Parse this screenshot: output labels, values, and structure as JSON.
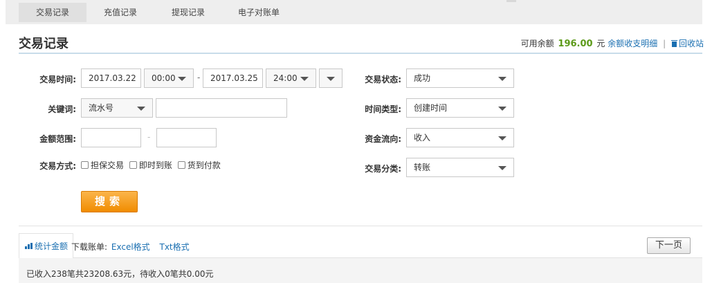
{
  "tabs": [
    {
      "label": "交易记录",
      "active": true
    },
    {
      "label": "充值记录",
      "active": false
    },
    {
      "label": "提现记录",
      "active": false
    },
    {
      "label": "电子对账单",
      "active": false
    }
  ],
  "header": {
    "title": "交易记录",
    "balance_label": "可用余额",
    "balance_amount": "196.00",
    "balance_unit": "元",
    "balance_detail_link": "余额收支明细",
    "separator": "|",
    "recycle_link": "回收站"
  },
  "form": {
    "time_label": "交易时间:",
    "start_date": "2017.03.22",
    "start_time": "00:00",
    "range_dash": "-",
    "end_date": "2017.03.25",
    "end_time": "24:00",
    "keyword_label": "关键词:",
    "keyword_type": "流水号",
    "keyword_value": "",
    "amount_label": "金额范围:",
    "amount_min": "",
    "amount_dash": "-",
    "amount_max": "",
    "method_label": "交易方式:",
    "methods": [
      {
        "label": "担保交易",
        "checked": false
      },
      {
        "label": "即时到账",
        "checked": false
      },
      {
        "label": "货到付款",
        "checked": false
      }
    ],
    "status_label": "交易状态:",
    "status_value": "成功",
    "time_type_label": "时间类型:",
    "time_type_value": "创建时间",
    "flow_label": "资金流向:",
    "flow_value": "收入",
    "category_label": "交易分类:",
    "category_value": "转账",
    "search_button": "搜索"
  },
  "results": {
    "stat_tab": "统计金额",
    "download_label": "下载账单:",
    "excel_link": "Excel格式",
    "txt_link": "Txt格式",
    "next_page": "下一页",
    "summary": "已收入238笔共23208.63元，待收入0笔共0.00元"
  },
  "colors": {
    "accent_link": "#1a6fb1",
    "balance_green": "#5c9a19",
    "search_orange": "#f08c00"
  }
}
